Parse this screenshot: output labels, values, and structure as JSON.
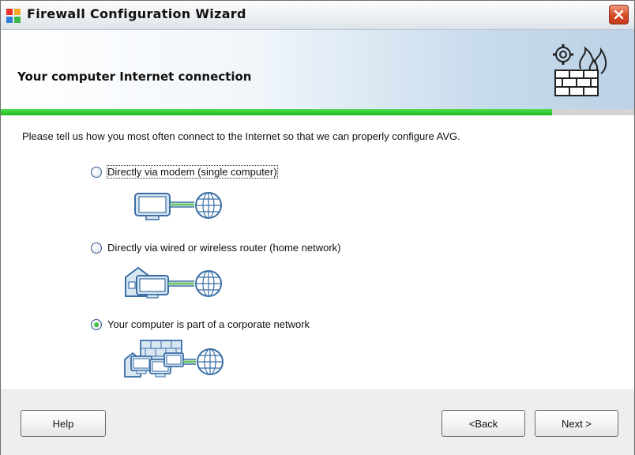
{
  "window": {
    "title": "Firewall Configuration Wizard",
    "title_icon": "avg-flag-icon",
    "close_icon": "close-icon"
  },
  "header": {
    "title": "Your computer Internet connection",
    "icon": "firewall-gear-flame-icon"
  },
  "progress": {
    "fraction": 0.87,
    "color": "#2fc92f"
  },
  "prompt": "Please tell us how you most often connect to the Internet so that we can properly configure AVG.",
  "options": [
    {
      "label": "Directly via modem (single computer)",
      "checked": false,
      "icon": "monitor-to-globe-icon"
    },
    {
      "label": "Directly via wired or wireless router (home network)",
      "checked": false,
      "icon": "home-computer-to-globe-icon"
    },
    {
      "label": "Your computer is part of a corporate network",
      "checked": true,
      "icon": "corporate-network-to-globe-icon"
    }
  ],
  "buttons": {
    "help": "Help",
    "back": "<Back",
    "next": "Next >"
  }
}
